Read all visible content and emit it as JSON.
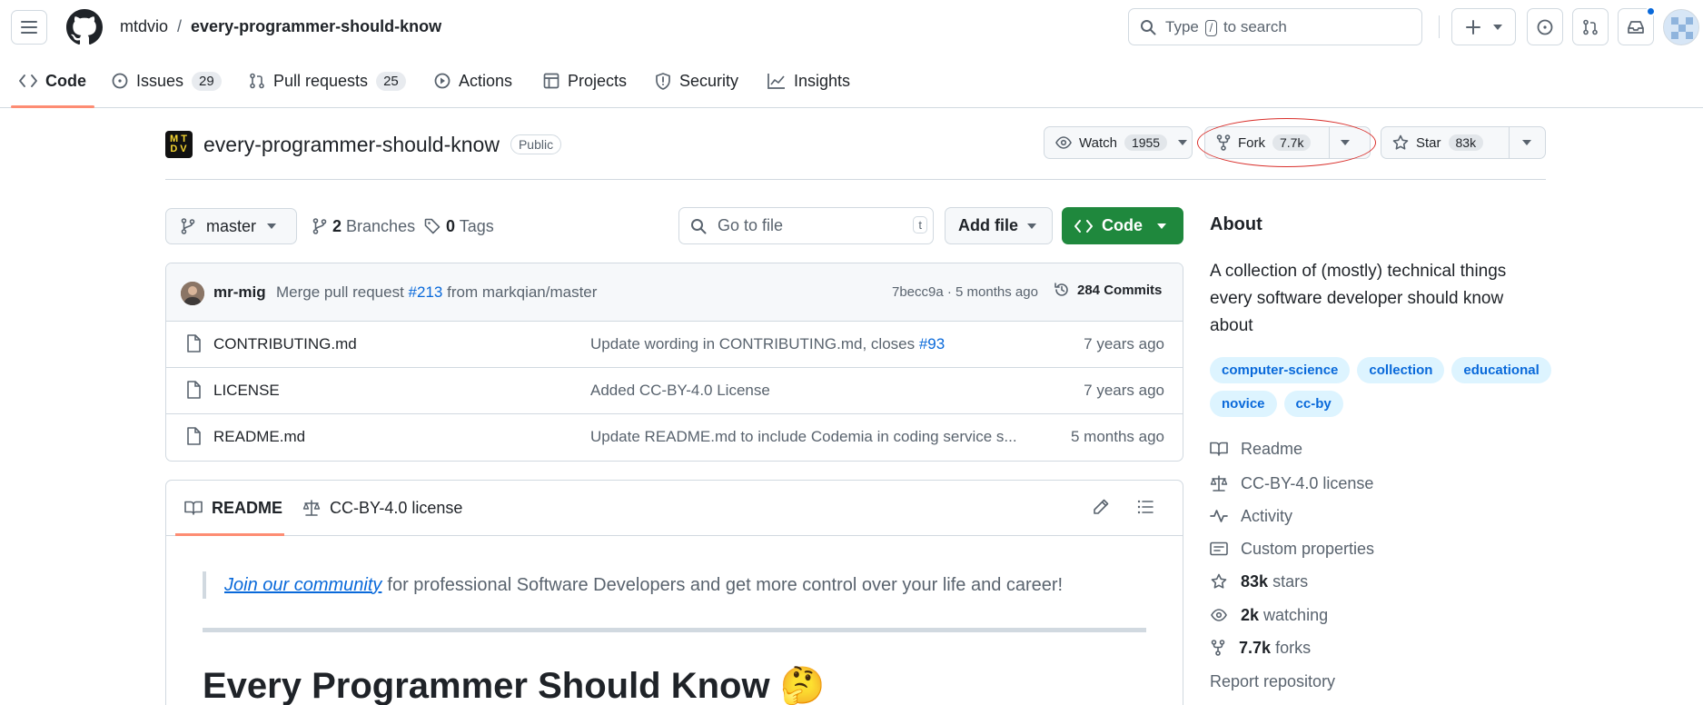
{
  "header": {
    "owner": "mtdvio",
    "separator": "/",
    "repo": "every-programmer-should-know",
    "search": {
      "prefix": "Type",
      "key": "/",
      "suffix": "to search"
    }
  },
  "nav": {
    "code": "Code",
    "issues": "Issues",
    "issues_count": "29",
    "pulls": "Pull requests",
    "pulls_count": "25",
    "actions": "Actions",
    "projects": "Projects",
    "security": "Security",
    "insights": "Insights"
  },
  "repo": {
    "logo_text_top": "MT",
    "logo_text_bottom": "DV",
    "name": "every-programmer-should-know",
    "visibility": "Public",
    "watch_label": "Watch",
    "watch_count": "1955",
    "fork_label": "Fork",
    "fork_count": "7.7k",
    "star_label": "Star",
    "star_count": "83k"
  },
  "controls": {
    "branch": "master",
    "branches": "2 Branches",
    "branches_num": "2",
    "branches_word": "Branches",
    "tags_num": "0",
    "tags_word": "Tags",
    "goto_placeholder": "Go to file",
    "goto_key": "t",
    "add_file": "Add file",
    "code": "Code"
  },
  "commit": {
    "author": "mr-mig",
    "message_prefix": "Merge pull request",
    "pr": "#213",
    "message_suffix": "from markqian/master",
    "sha_time": "7becc9a · 5 months ago",
    "commits": "284 Commits"
  },
  "files": [
    {
      "name": "CONTRIBUTING.md",
      "message": "Update wording in CONTRIBUTING.md, closes",
      "issue": "#93",
      "age": "7 years ago"
    },
    {
      "name": "LICENSE",
      "message": "Added CC-BY-4.0 License",
      "issue": "",
      "age": "7 years ago"
    },
    {
      "name": "README.md",
      "message": "Update README.md to include Codemia in coding service s...",
      "issue": "",
      "age": "5 months ago"
    }
  ],
  "readme": {
    "tab_readme": "README",
    "tab_license": "CC-BY-4.0 license",
    "quote_link": "Join our community",
    "quote_text": "for professional Software Developers and get more control over your life and career!",
    "heading": "Every Programmer Should Know",
    "heading_emoji": "🤔"
  },
  "about": {
    "title": "About",
    "description": "A collection of (mostly) technical things every software developer should know about",
    "topics": [
      "computer-science",
      "collection",
      "educational",
      "novice",
      "cc-by"
    ],
    "readme": "Readme",
    "license": "CC-BY-4.0 license",
    "activity": "Activity",
    "custom": "Custom properties",
    "stars_num": "83k",
    "stars_word": "stars",
    "watching_num": "2k",
    "watching_word": "watching",
    "forks_num": "7.7k",
    "forks_word": "forks",
    "report": "Report repository"
  },
  "colors": {
    "accent": "#0969da",
    "green": "#1f883d",
    "tab_underline": "#fd8c73",
    "annotation": "#d9302c"
  }
}
